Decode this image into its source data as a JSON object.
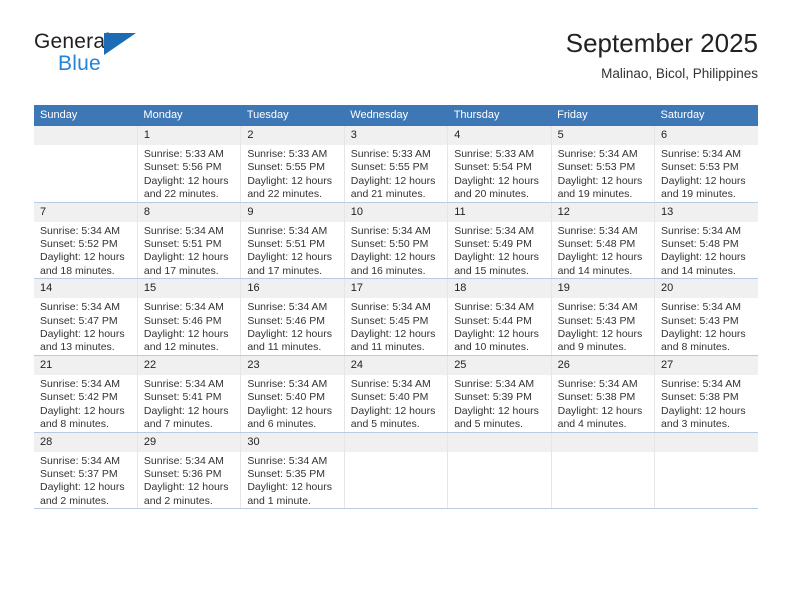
{
  "brand": {
    "name_top": "General",
    "name_bottom": "Blue",
    "accent_color": "#2484d7",
    "triangle_color": "#1b6cb5"
  },
  "header": {
    "title": "September 2025",
    "subtitle": "Malinao, Bicol, Philippines"
  },
  "theme": {
    "header_row_color": "#3d77b6",
    "daynum_band_color": "#f0f0f0",
    "grid_line_color": "#b9cbe0"
  },
  "weekdays": [
    "Sunday",
    "Monday",
    "Tuesday",
    "Wednesday",
    "Thursday",
    "Friday",
    "Saturday"
  ],
  "weeks": [
    [
      {
        "day": "",
        "sunrise": "",
        "sunset": "",
        "daylight1": "",
        "daylight2": ""
      },
      {
        "day": "1",
        "sunrise": "Sunrise: 5:33 AM",
        "sunset": "Sunset: 5:56 PM",
        "daylight1": "Daylight: 12 hours",
        "daylight2": "and 22 minutes."
      },
      {
        "day": "2",
        "sunrise": "Sunrise: 5:33 AM",
        "sunset": "Sunset: 5:55 PM",
        "daylight1": "Daylight: 12 hours",
        "daylight2": "and 22 minutes."
      },
      {
        "day": "3",
        "sunrise": "Sunrise: 5:33 AM",
        "sunset": "Sunset: 5:55 PM",
        "daylight1": "Daylight: 12 hours",
        "daylight2": "and 21 minutes."
      },
      {
        "day": "4",
        "sunrise": "Sunrise: 5:33 AM",
        "sunset": "Sunset: 5:54 PM",
        "daylight1": "Daylight: 12 hours",
        "daylight2": "and 20 minutes."
      },
      {
        "day": "5",
        "sunrise": "Sunrise: 5:34 AM",
        "sunset": "Sunset: 5:53 PM",
        "daylight1": "Daylight: 12 hours",
        "daylight2": "and 19 minutes."
      },
      {
        "day": "6",
        "sunrise": "Sunrise: 5:34 AM",
        "sunset": "Sunset: 5:53 PM",
        "daylight1": "Daylight: 12 hours",
        "daylight2": "and 19 minutes."
      }
    ],
    [
      {
        "day": "7",
        "sunrise": "Sunrise: 5:34 AM",
        "sunset": "Sunset: 5:52 PM",
        "daylight1": "Daylight: 12 hours",
        "daylight2": "and 18 minutes."
      },
      {
        "day": "8",
        "sunrise": "Sunrise: 5:34 AM",
        "sunset": "Sunset: 5:51 PM",
        "daylight1": "Daylight: 12 hours",
        "daylight2": "and 17 minutes."
      },
      {
        "day": "9",
        "sunrise": "Sunrise: 5:34 AM",
        "sunset": "Sunset: 5:51 PM",
        "daylight1": "Daylight: 12 hours",
        "daylight2": "and 17 minutes."
      },
      {
        "day": "10",
        "sunrise": "Sunrise: 5:34 AM",
        "sunset": "Sunset: 5:50 PM",
        "daylight1": "Daylight: 12 hours",
        "daylight2": "and 16 minutes."
      },
      {
        "day": "11",
        "sunrise": "Sunrise: 5:34 AM",
        "sunset": "Sunset: 5:49 PM",
        "daylight1": "Daylight: 12 hours",
        "daylight2": "and 15 minutes."
      },
      {
        "day": "12",
        "sunrise": "Sunrise: 5:34 AM",
        "sunset": "Sunset: 5:48 PM",
        "daylight1": "Daylight: 12 hours",
        "daylight2": "and 14 minutes."
      },
      {
        "day": "13",
        "sunrise": "Sunrise: 5:34 AM",
        "sunset": "Sunset: 5:48 PM",
        "daylight1": "Daylight: 12 hours",
        "daylight2": "and 14 minutes."
      }
    ],
    [
      {
        "day": "14",
        "sunrise": "Sunrise: 5:34 AM",
        "sunset": "Sunset: 5:47 PM",
        "daylight1": "Daylight: 12 hours",
        "daylight2": "and 13 minutes."
      },
      {
        "day": "15",
        "sunrise": "Sunrise: 5:34 AM",
        "sunset": "Sunset: 5:46 PM",
        "daylight1": "Daylight: 12 hours",
        "daylight2": "and 12 minutes."
      },
      {
        "day": "16",
        "sunrise": "Sunrise: 5:34 AM",
        "sunset": "Sunset: 5:46 PM",
        "daylight1": "Daylight: 12 hours",
        "daylight2": "and 11 minutes."
      },
      {
        "day": "17",
        "sunrise": "Sunrise: 5:34 AM",
        "sunset": "Sunset: 5:45 PM",
        "daylight1": "Daylight: 12 hours",
        "daylight2": "and 11 minutes."
      },
      {
        "day": "18",
        "sunrise": "Sunrise: 5:34 AM",
        "sunset": "Sunset: 5:44 PM",
        "daylight1": "Daylight: 12 hours",
        "daylight2": "and 10 minutes."
      },
      {
        "day": "19",
        "sunrise": "Sunrise: 5:34 AM",
        "sunset": "Sunset: 5:43 PM",
        "daylight1": "Daylight: 12 hours",
        "daylight2": "and 9 minutes."
      },
      {
        "day": "20",
        "sunrise": "Sunrise: 5:34 AM",
        "sunset": "Sunset: 5:43 PM",
        "daylight1": "Daylight: 12 hours",
        "daylight2": "and 8 minutes."
      }
    ],
    [
      {
        "day": "21",
        "sunrise": "Sunrise: 5:34 AM",
        "sunset": "Sunset: 5:42 PM",
        "daylight1": "Daylight: 12 hours",
        "daylight2": "and 8 minutes."
      },
      {
        "day": "22",
        "sunrise": "Sunrise: 5:34 AM",
        "sunset": "Sunset: 5:41 PM",
        "daylight1": "Daylight: 12 hours",
        "daylight2": "and 7 minutes."
      },
      {
        "day": "23",
        "sunrise": "Sunrise: 5:34 AM",
        "sunset": "Sunset: 5:40 PM",
        "daylight1": "Daylight: 12 hours",
        "daylight2": "and 6 minutes."
      },
      {
        "day": "24",
        "sunrise": "Sunrise: 5:34 AM",
        "sunset": "Sunset: 5:40 PM",
        "daylight1": "Daylight: 12 hours",
        "daylight2": "and 5 minutes."
      },
      {
        "day": "25",
        "sunrise": "Sunrise: 5:34 AM",
        "sunset": "Sunset: 5:39 PM",
        "daylight1": "Daylight: 12 hours",
        "daylight2": "and 5 minutes."
      },
      {
        "day": "26",
        "sunrise": "Sunrise: 5:34 AM",
        "sunset": "Sunset: 5:38 PM",
        "daylight1": "Daylight: 12 hours",
        "daylight2": "and 4 minutes."
      },
      {
        "day": "27",
        "sunrise": "Sunrise: 5:34 AM",
        "sunset": "Sunset: 5:38 PM",
        "daylight1": "Daylight: 12 hours",
        "daylight2": "and 3 minutes."
      }
    ],
    [
      {
        "day": "28",
        "sunrise": "Sunrise: 5:34 AM",
        "sunset": "Sunset: 5:37 PM",
        "daylight1": "Daylight: 12 hours",
        "daylight2": "and 2 minutes."
      },
      {
        "day": "29",
        "sunrise": "Sunrise: 5:34 AM",
        "sunset": "Sunset: 5:36 PM",
        "daylight1": "Daylight: 12 hours",
        "daylight2": "and 2 minutes."
      },
      {
        "day": "30",
        "sunrise": "Sunrise: 5:34 AM",
        "sunset": "Sunset: 5:35 PM",
        "daylight1": "Daylight: 12 hours",
        "daylight2": "and 1 minute."
      },
      {
        "day": "",
        "sunrise": "",
        "sunset": "",
        "daylight1": "",
        "daylight2": ""
      },
      {
        "day": "",
        "sunrise": "",
        "sunset": "",
        "daylight1": "",
        "daylight2": ""
      },
      {
        "day": "",
        "sunrise": "",
        "sunset": "",
        "daylight1": "",
        "daylight2": ""
      },
      {
        "day": "",
        "sunrise": "",
        "sunset": "",
        "daylight1": "",
        "daylight2": ""
      }
    ]
  ]
}
